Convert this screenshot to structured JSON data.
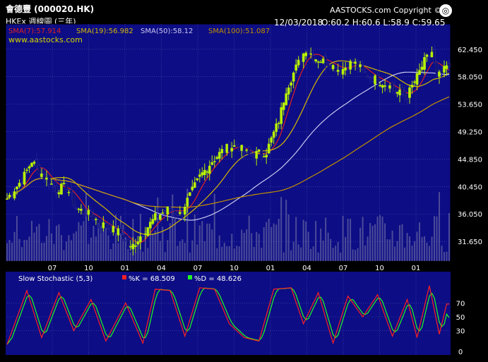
{
  "header": {
    "stock_title": "會德豐 (000020.HK)",
    "subtitle": "HKEx 週線圖 (三年)",
    "copyright": "AASTOCKS.com Copyright ©",
    "date": "12/03/2018",
    "ohlc": "O:60.2  H:60.6  L:58.9  C:59.65",
    "website": "www.aastocks.com"
  },
  "legend": {
    "sma7": "SMA(7):57.914",
    "sma19": "SMA(19):56.982",
    "sma50": "SMA(50):58.12",
    "sma100": "SMA(100):51.087"
  },
  "stochastic": {
    "title": "Slow Stochastic (5,3)",
    "k_label": "%K = 68.509",
    "d_label": "%D = 48.626"
  },
  "colors": {
    "background": "#000000",
    "plot_bg": "#0d0d85",
    "up_candle": "#b8f000",
    "down_candle": "#101070",
    "sma7": "#e02020",
    "sma19": "#d4b800",
    "sma50": "#c8c8f0",
    "sma100": "#c09000",
    "k_line": "#ff2020",
    "d_line": "#20ff20",
    "volume": "#6060a0",
    "grid": "#5050b0"
  },
  "chart_data": [
    {
      "type": "candlestick",
      "title": "會德豐 (000020.HK)",
      "ylim": [
        28.5,
        66.5
      ],
      "y_ticks": [
        "62.450",
        "58.050",
        "53.650",
        "49.250",
        "44.850",
        "40.450",
        "36.050",
        "31.650"
      ],
      "x_ticks": [
        "07",
        "10",
        "01",
        "04",
        "07",
        "10",
        "01",
        "04",
        "07",
        "10",
        "01"
      ],
      "close_path": [
        [
          0,
          38.5
        ],
        [
          6,
          41.5
        ],
        [
          10,
          44.5
        ],
        [
          15,
          42
        ],
        [
          20,
          40
        ],
        [
          24,
          40.5
        ],
        [
          28,
          37
        ],
        [
          33,
          36
        ],
        [
          40,
          34
        ],
        [
          46,
          33
        ],
        [
          50,
          30.5
        ],
        [
          55,
          33
        ],
        [
          60,
          35.5
        ],
        [
          66,
          37
        ],
        [
          70,
          36
        ],
        [
          78,
          42
        ],
        [
          83,
          44.5
        ],
        [
          88,
          46.5
        ],
        [
          93,
          47
        ],
        [
          98,
          45.5
        ],
        [
          105,
          46
        ],
        [
          110,
          51
        ],
        [
          113,
          56
        ],
        [
          117,
          59.5
        ],
        [
          121,
          62.5
        ],
        [
          125,
          61
        ],
        [
          130,
          60.2
        ],
        [
          135,
          59
        ],
        [
          140,
          60.5
        ],
        [
          145,
          58.5
        ],
        [
          150,
          57.5
        ],
        [
          155,
          56.5
        ],
        [
          158,
          55.5
        ],
        [
          162,
          55
        ],
        [
          166,
          58
        ],
        [
          169,
          60.5
        ],
        [
          172,
          62
        ],
        [
          174,
          58
        ],
        [
          176,
          58.5
        ],
        [
          178,
          59.65
        ]
      ],
      "sma": [
        {
          "name": "SMA(7)",
          "value": 57.914
        },
        {
          "name": "SMA(19)",
          "value": 56.982
        },
        {
          "name": "SMA(50)",
          "value": 58.12
        },
        {
          "name": "SMA(100)",
          "value": 51.087
        }
      ],
      "last": {
        "open": 60.2,
        "high": 60.6,
        "low": 58.9,
        "close": 59.65
      }
    },
    {
      "type": "line",
      "title": "Slow Stochastic (5,3)",
      "ylim": [
        0,
        100
      ],
      "y_ticks": [
        0,
        30,
        50,
        70
      ],
      "series": [
        {
          "name": "%K",
          "last": 68.509
        },
        {
          "name": "%D",
          "last": 48.626
        }
      ],
      "k_path": [
        [
          0,
          10
        ],
        [
          8,
          88
        ],
        [
          14,
          20
        ],
        [
          21,
          85
        ],
        [
          27,
          30
        ],
        [
          34,
          75
        ],
        [
          40,
          15
        ],
        [
          48,
          70
        ],
        [
          55,
          12
        ],
        [
          60,
          90
        ],
        [
          66,
          88
        ],
        [
          72,
          22
        ],
        [
          78,
          92
        ],
        [
          84,
          90
        ],
        [
          90,
          40
        ],
        [
          96,
          20
        ],
        [
          102,
          15
        ],
        [
          108,
          90
        ],
        [
          115,
          92
        ],
        [
          120,
          40
        ],
        [
          126,
          85
        ],
        [
          132,
          12
        ],
        [
          138,
          80
        ],
        [
          144,
          50
        ],
        [
          150,
          82
        ],
        [
          156,
          22
        ],
        [
          162,
          75
        ],
        [
          166,
          20
        ],
        [
          171,
          95
        ],
        [
          175,
          25
        ],
        [
          178,
          68.5
        ]
      ]
    }
  ]
}
